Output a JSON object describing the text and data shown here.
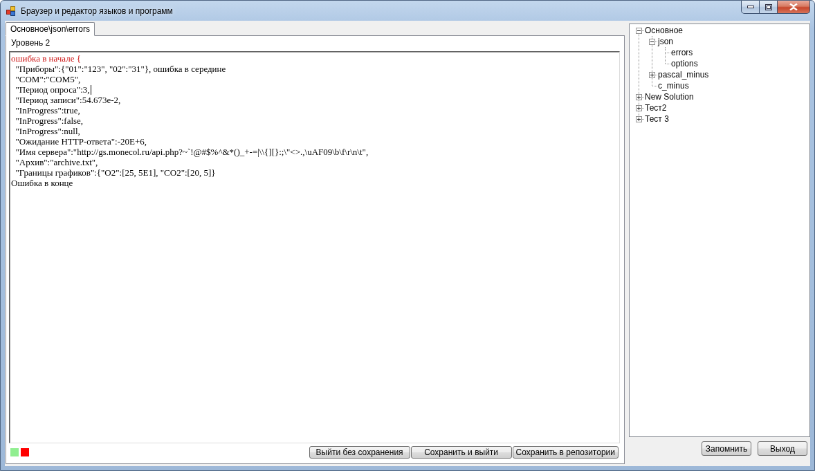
{
  "window": {
    "title": "Браузер и редактор языков и программ"
  },
  "tabs": [
    {
      "label": "Основное\\json\\errors",
      "selected": true
    }
  ],
  "editor": {
    "level_label": "Уровень 2",
    "lines": [
      {
        "text": "ошибка в начале {",
        "highlighted": true,
        "caret": false
      },
      {
        "text": "  \"Приборы\":{\"01\":\"123\", \"02\":\"31\"}, ошибка в середине",
        "highlighted": false,
        "caret": false
      },
      {
        "text": "  \"COM\":\"COM5\",",
        "highlighted": false,
        "caret": false
      },
      {
        "text": "  \"Период опроса\":3,",
        "highlighted": false,
        "caret": true
      },
      {
        "text": "  \"Период записи\":54.673e-2,",
        "highlighted": false,
        "caret": false
      },
      {
        "text": "  \"InProgress\":true,",
        "highlighted": false,
        "caret": false
      },
      {
        "text": "  \"InProgress\":false,",
        "highlighted": false,
        "caret": false
      },
      {
        "text": "  \"InProgress\":null,",
        "highlighted": false,
        "caret": false
      },
      {
        "text": "  \"Ожидание HTTP-ответа\":-20E+6,",
        "highlighted": false,
        "caret": false
      },
      {
        "text": "  \"Имя сервера\":\"http://gs.monecol.ru/api.php?~`!@#$%^&*()_+-=|\\\\{][}:;\\\"<>.,\\uAF09\\b\\f\\r\\n\\t\",",
        "highlighted": false,
        "caret": false
      },
      {
        "text": "  \"Архив\":\"archive.txt\",",
        "highlighted": false,
        "caret": false
      },
      {
        "text": "  \"Границы графиков\":{\"O2\":[25, 5E1], \"CO2\":[20, 5]}",
        "highlighted": false,
        "caret": false
      },
      {
        "text": "Ошибка в конце",
        "highlighted": false,
        "caret": false
      }
    ]
  },
  "status_indicators": [
    {
      "color": "#90ee90"
    },
    {
      "color": "#ff0000"
    }
  ],
  "editor_buttons": [
    "Выйти без сохранения",
    "Сохранить и выйти",
    "Сохранить в репозитории"
  ],
  "tree": {
    "items": [
      {
        "label": "Основное",
        "kind": "branch",
        "expanded": true,
        "children": [
          {
            "label": "json",
            "kind": "branch",
            "expanded": true,
            "children": [
              {
                "label": "errors",
                "kind": "leaf"
              },
              {
                "label": "options",
                "kind": "leaf"
              }
            ]
          },
          {
            "label": "pascal_minus",
            "kind": "branch",
            "expanded": false
          },
          {
            "label": "c_minus",
            "kind": "leaf"
          }
        ]
      },
      {
        "label": "New Solution",
        "kind": "branch",
        "expanded": false
      },
      {
        "label": "Тест2",
        "kind": "branch",
        "expanded": false
      },
      {
        "label": "Тест 3",
        "kind": "branch",
        "expanded": false
      }
    ]
  },
  "buttons": [
    "Запомнить",
    "Выход"
  ]
}
